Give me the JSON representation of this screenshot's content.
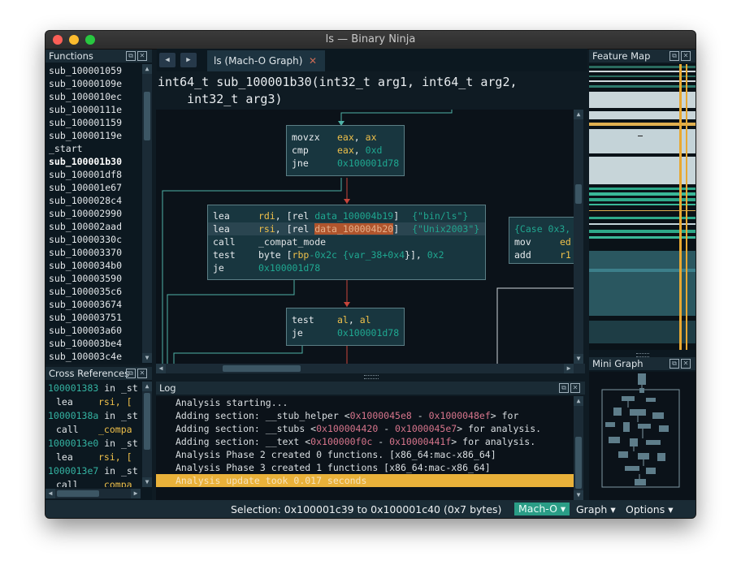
{
  "window": {
    "title": "ls — Binary Ninja"
  },
  "functions_panel": {
    "title": "Functions",
    "selected_index": 7,
    "items": [
      "sub_100001059",
      "sub_10000109e",
      "sub_1000010ec",
      "sub_10000111e",
      "sub_100001159",
      "sub_10000119e",
      "_start",
      "sub_100001b30",
      "sub_100001df8",
      "sub_100001e67",
      "sub_1000028c4",
      "sub_100002990",
      "sub_100002aad",
      "sub_10000330c",
      "sub_100003370",
      "sub_1000034b0",
      "sub_100003590",
      "sub_1000035c6",
      "sub_100003674",
      "sub_100003751",
      "sub_100003a60",
      "sub_100003be4",
      "sub_100003c4e"
    ]
  },
  "xref_panel": {
    "title": "Cross References",
    "entries": [
      {
        "addr": "100001383",
        "ctx": " in _st",
        "mn": "lea",
        "arg": "rsi, ["
      },
      {
        "addr": "10000138a",
        "ctx": " in _st",
        "mn": "call",
        "arg": "_compa"
      },
      {
        "addr": "1000013e0",
        "ctx": " in _st",
        "mn": "lea",
        "arg": "rsi, ["
      },
      {
        "addr": "1000013e7",
        "ctx": " in _st",
        "mn": "call",
        "arg": "_compa"
      }
    ]
  },
  "tab": {
    "label": "ls (Mach-O Graph)",
    "close": "✕",
    "back": "◀",
    "forward": "▶"
  },
  "signature": {
    "line1": "int64_t sub_100001b30(int32_t arg1, int64_t arg2,",
    "line2": "    int32_t arg3)"
  },
  "graph": {
    "block1": [
      {
        "mn": "movzx",
        "a1": "eax",
        "sep": ", ",
        "a2": "ax"
      },
      {
        "mn": "cmp",
        "a1": "eax",
        "sep": ", ",
        "a2": "0xd"
      },
      {
        "mn": "jne",
        "a1": "",
        "sep": "",
        "a2": "0x100001d78"
      }
    ],
    "block2": {
      "l1": {
        "mn": "lea",
        "reg": "rdi",
        "pre": ", [rel ",
        "dat": "data_100004b19",
        "post": "]",
        "str": "{\"bin/ls\"}"
      },
      "l2": {
        "mn": "lea",
        "reg": "rsi",
        "pre": ", [rel ",
        "dat": "data_100004b20",
        "post": "]",
        "str": "{\"Unix2003\"}"
      },
      "l3": {
        "mn": "call",
        "sym": "_compat_mode"
      },
      "l4": {
        "mn": "test",
        "t1": "byte [",
        "reg": "rbp",
        "n1": "-0x2c",
        "t2": " {var_38+",
        "n2": "0x4",
        "t3": "}], ",
        "n3": "0x2"
      },
      "l5": {
        "mn": "je",
        "addr": "0x100001d78"
      }
    },
    "block3": [
      {
        "mn": "test",
        "a1": "al",
        "sep": ", ",
        "a2": "al"
      },
      {
        "mn": "je",
        "a1": "",
        "sep": "",
        "a2": "0x100001d78"
      }
    ],
    "block4": {
      "l1": "{Case 0x3,",
      "l2_mn": "mov",
      "l2_reg": "ed",
      "l3_mn": "add",
      "l3_reg": "r1"
    }
  },
  "feature_map": {
    "title": "Feature Map"
  },
  "mini_graph": {
    "title": "Mini Graph"
  },
  "log": {
    "title": "Log",
    "lines": [
      {
        "pre": "Analysis starting...",
        "n1": "",
        "mid": "",
        "n2": "",
        "post": ""
      },
      {
        "pre": "Adding section: __stub_helper <",
        "n1": "0x1000045e8",
        "mid": " - ",
        "n2": "0x1000048ef",
        "post": "> for"
      },
      {
        "pre": "Adding section: __stubs <",
        "n1": "0x100004420",
        "mid": " - ",
        "n2": "0x1000045e7",
        "post": "> for analysis."
      },
      {
        "pre": "Adding section: __text <",
        "n1": "0x100000f0c",
        "mid": " - ",
        "n2": "0x10000441f",
        "post": "> for analysis."
      },
      {
        "pre": "Analysis Phase 2 created 0 functions. [x86_64:mac-x86_64]",
        "n1": "",
        "mid": "",
        "n2": "",
        "post": ""
      },
      {
        "pre": "Analysis Phase 3 created 1 functions [x86_64:mac-x86_64]",
        "n1": "",
        "mid": "",
        "n2": "",
        "post": ""
      },
      {
        "pre": "Analysis update took 0.017 seconds",
        "n1": "",
        "mid": "",
        "n2": "",
        "post": ""
      }
    ]
  },
  "status": {
    "selection": "Selection: 0x100001c39 to 0x100001c40 (0x7 bytes)",
    "view": "Mach-O ▾",
    "graph": "Graph ▾",
    "options": "Options ▾"
  },
  "colors": {
    "accent": "#2a9d86",
    "log_highlight": "#e9b13a",
    "register": "#efc04a",
    "address": "#1fa891"
  }
}
